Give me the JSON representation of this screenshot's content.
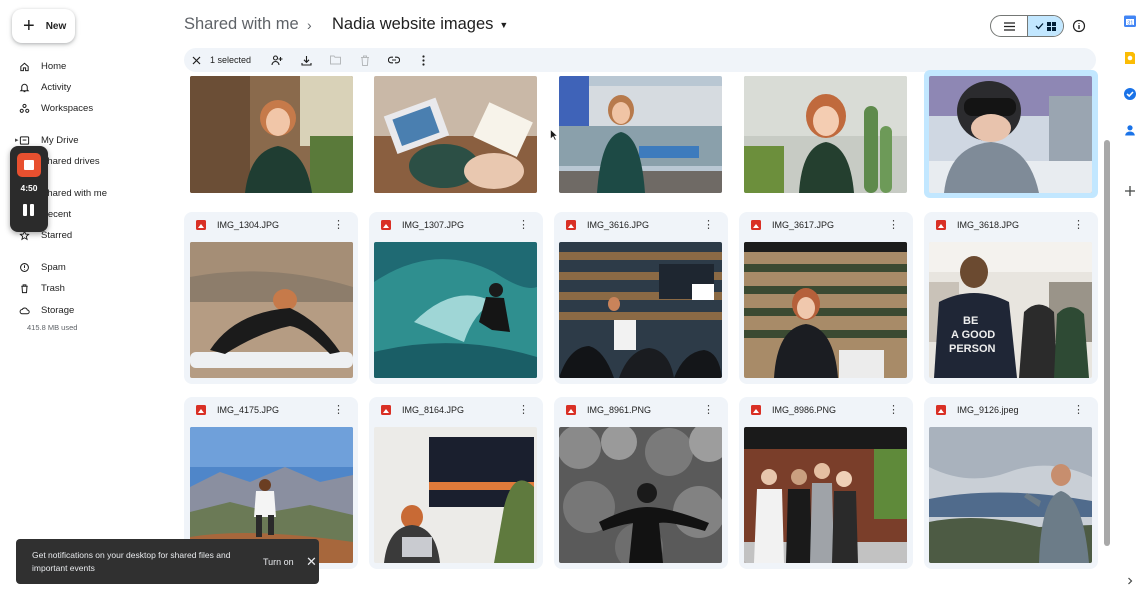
{
  "sidebar": {
    "new_label": "New",
    "items": [
      {
        "label": "Home",
        "icon": "home-icon"
      },
      {
        "label": "Activity",
        "icon": "bell-icon"
      },
      {
        "label": "Workspaces",
        "icon": "workspaces-icon"
      },
      {
        "label": "My Drive",
        "icon": "drive-icon"
      },
      {
        "label": "Shared drives",
        "icon": "shared-drives-icon"
      },
      {
        "label": "Shared with me",
        "icon": "people-icon"
      },
      {
        "label": "Recent",
        "icon": "clock-icon"
      },
      {
        "label": "Starred",
        "icon": "star-icon"
      },
      {
        "label": "Spam",
        "icon": "spam-icon"
      },
      {
        "label": "Trash",
        "icon": "trash-icon"
      },
      {
        "label": "Storage",
        "icon": "cloud-icon"
      }
    ],
    "storage_used": "415.8 MB used"
  },
  "recorder": {
    "time": "4:50",
    "accent": "#e8502f"
  },
  "header": {
    "breadcrumb_parent": "Shared with me",
    "breadcrumb_current": "Nadia website images"
  },
  "view": {
    "mode": "grid"
  },
  "toolbar": {
    "selection_label": "1 selected"
  },
  "files": {
    "top_row": [
      {
        "image": "woman-seated-interview"
      },
      {
        "image": "hands-tablet-drawing"
      },
      {
        "image": "woman-harbor-boats"
      },
      {
        "image": "woman-cactus-garden"
      },
      {
        "image": "woman-ski-goggles",
        "selected": true
      }
    ],
    "row2": [
      {
        "name": "IMG_1304.JPG",
        "image": "surfboard-sand-dune"
      },
      {
        "name": "IMG_1307.JPG",
        "image": "surfer-wave"
      },
      {
        "name": "IMG_3616.JPG",
        "image": "speaker-audience-stage"
      },
      {
        "name": "IMG_3617.JPG",
        "image": "woman-microphone-podium"
      },
      {
        "name": "IMG_3618.JPG",
        "image": "be-a-good-person-hoodie"
      }
    ],
    "row3": [
      {
        "name": "IMG_4175.JPG",
        "image": "trail-runner-mountains"
      },
      {
        "name": "IMG_8164.JPG",
        "image": "woman-laptop-screen"
      },
      {
        "name": "IMG_8961.PNG",
        "image": "bw-figure-trees"
      },
      {
        "name": "IMG_8986.PNG",
        "image": "group-graduation-photo"
      },
      {
        "name": "IMG_9126.jpeg",
        "image": "person-scenic-overlook"
      }
    ]
  },
  "snackbar": {
    "message": "Get notifications on your desktop for shared files and important events",
    "action": "Turn on"
  },
  "colors": {
    "selection": "#c2e7ff",
    "file_icon": "#d93025",
    "toolbar_bg": "#f0f4f9"
  }
}
